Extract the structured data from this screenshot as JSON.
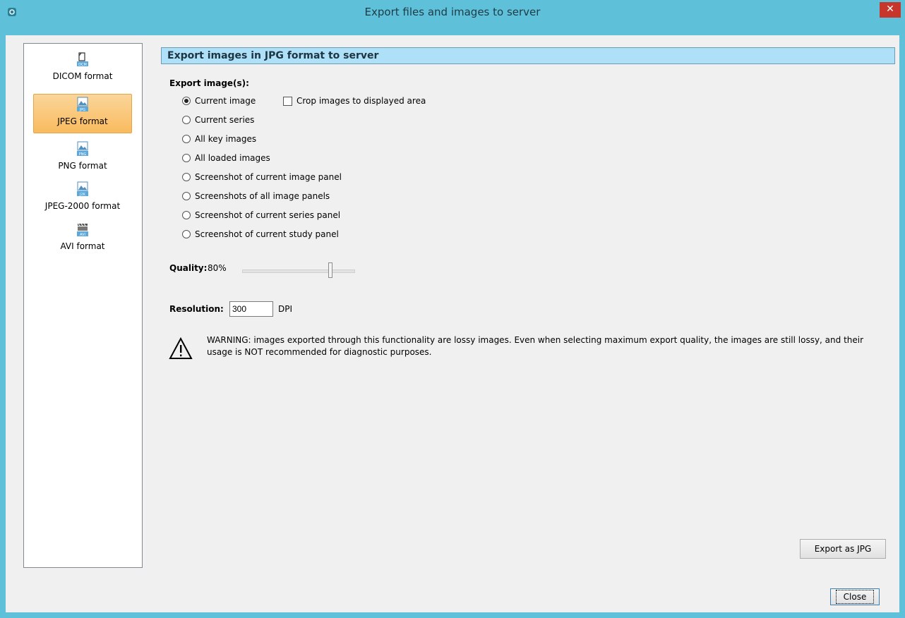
{
  "window": {
    "title": "Export files and images to server",
    "close_glyph": "✕"
  },
  "sidebar": {
    "items": [
      {
        "label": "DICOM format",
        "icon": "dcm-file-icon",
        "badge": "DCM",
        "selected": false
      },
      {
        "label": "JPEG format",
        "icon": "jpg-image-icon",
        "badge": "JPG",
        "selected": true
      },
      {
        "label": "PNG format",
        "icon": "png-image-icon",
        "badge": "PNG",
        "selected": false
      },
      {
        "label": "JPEG-2000 format",
        "icon": "j2k-image-icon",
        "badge": "J2K",
        "selected": false
      },
      {
        "label": "AVI format",
        "icon": "avi-film-icon",
        "badge": "AVI",
        "selected": false
      }
    ]
  },
  "main": {
    "header": "Export images in JPG format to server",
    "export_label": "Export image(s):",
    "options": [
      {
        "label": "Current image",
        "checked": true
      },
      {
        "label": "Current series",
        "checked": false
      },
      {
        "label": "All key images",
        "checked": false
      },
      {
        "label": "All loaded images",
        "checked": false
      },
      {
        "label": "Screenshot of current image panel",
        "checked": false
      },
      {
        "label": "Screenshots of all image panels",
        "checked": false
      },
      {
        "label": "Screenshot of current series panel",
        "checked": false
      },
      {
        "label": "Screenshot of current study panel",
        "checked": false
      }
    ],
    "crop_checkbox": {
      "label": "Crop images to displayed area",
      "checked": false
    },
    "quality": {
      "label": "Quality:",
      "value_text": "80%",
      "value": 0.8
    },
    "resolution": {
      "label": "Resolution:",
      "value": "300",
      "unit": "DPI"
    },
    "warning": "WARNING: images exported through this functionality are lossy images. Even when selecting maximum export quality, the images are still lossy, and their usage is NOT recommended for diagnostic purposes.",
    "export_button": "Export as JPG",
    "close_button": "Close"
  },
  "colors": {
    "frame": "#5fc1d9",
    "header_bg": "#aee0f7",
    "selected_item": "#f9bb5e",
    "close_red": "#c7362b"
  }
}
